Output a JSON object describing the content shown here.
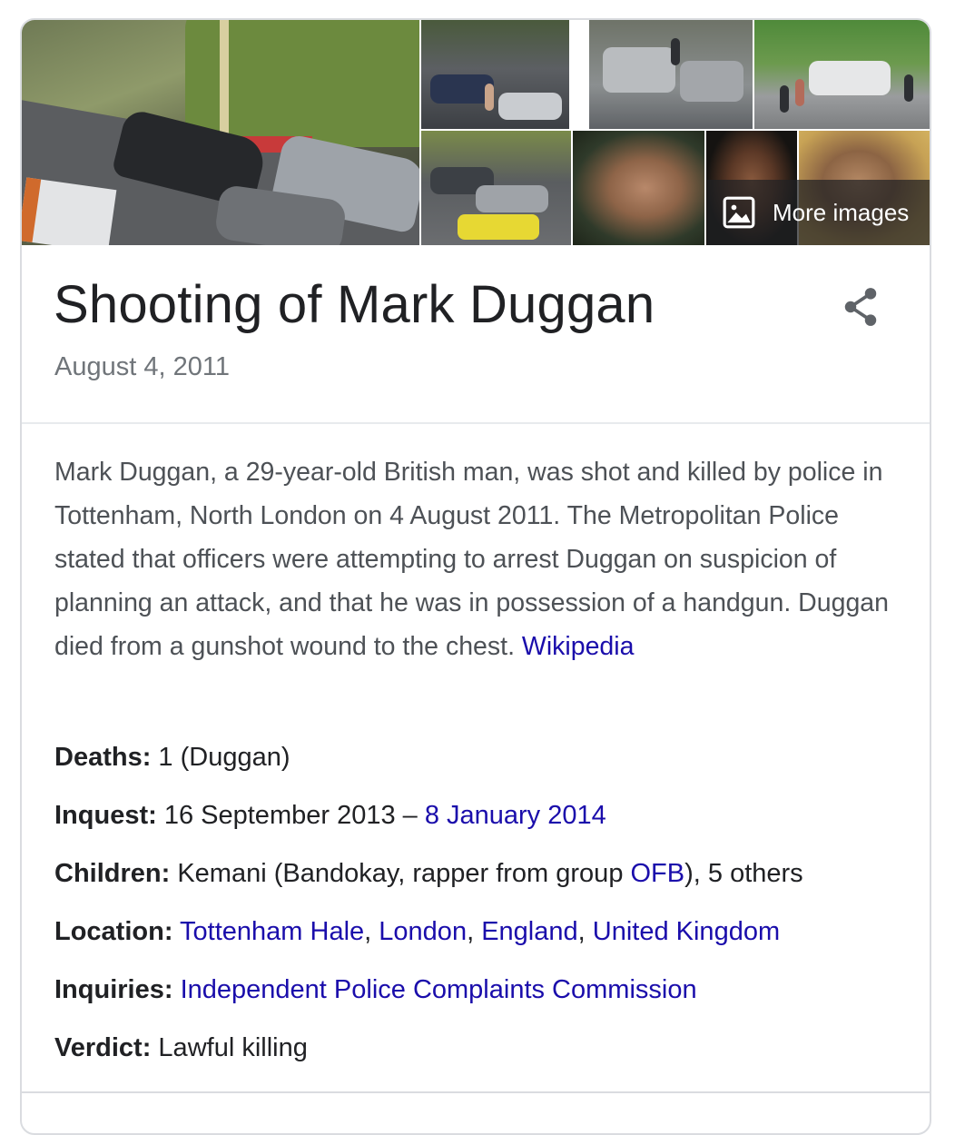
{
  "images": {
    "more_images_label": "More images",
    "icon": "image-icon"
  },
  "title": "Shooting of Mark Duggan",
  "subtitle": "August 4, 2011",
  "share_icon": "share-icon",
  "description": {
    "text": "Mark Duggan, a 29-year-old British man, was shot and killed by police in Tottenham, North London on 4 August 2011. The Metropolitan Police stated that officers were attempting to arrest Duggan on suspicion of planning an attack, and that he was in possession of a handgun. Duggan died from a gunshot wound to the chest. ",
    "source_link": "Wikipedia"
  },
  "facts": {
    "deaths": {
      "label": "Deaths:",
      "value": " 1 (Duggan)"
    },
    "inquest": {
      "label": "Inquest:",
      "value": " 16 September 2013 – ",
      "link": "8 January 2014"
    },
    "children": {
      "label": "Children:",
      "value_before": " Kemani (Bandokay, rapper from group ",
      "link": "OFB",
      "value_after": "), 5 others"
    },
    "location": {
      "label": "Location:",
      "links": [
        "Tottenham Hale",
        "London",
        "England",
        "United Kingdom"
      ],
      "separator": ", "
    },
    "inquiries": {
      "label": "Inquiries:",
      "link": "Independent Police Complaints Commission"
    },
    "verdict": {
      "label": "Verdict:",
      "value": " Lawful killing"
    }
  },
  "colors": {
    "link": "#1a0dab",
    "title": "#202124",
    "subtitle": "#70757a",
    "body": "#4d5156",
    "border": "#dadce0"
  }
}
